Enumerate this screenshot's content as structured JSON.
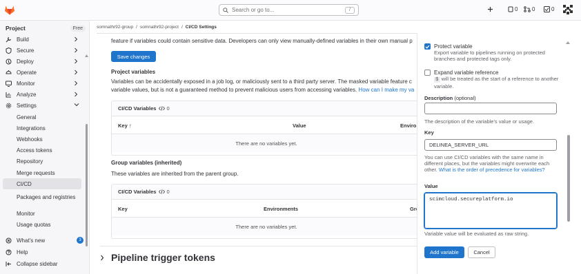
{
  "topbar": {
    "search_placeholder": "Search or go to...",
    "search_shortcut": "/",
    "issues_count": "0",
    "mr_count": "0",
    "todo_count": "0"
  },
  "sidebar": {
    "title": "Project",
    "badge": "Free",
    "items": [
      {
        "label": "Build",
        "icon": "build-icon"
      },
      {
        "label": "Secure",
        "icon": "shield-icon"
      },
      {
        "label": "Deploy",
        "icon": "deploy-icon"
      },
      {
        "label": "Operate",
        "icon": "operate-icon"
      },
      {
        "label": "Monitor",
        "icon": "monitor-icon"
      },
      {
        "label": "Analyze",
        "icon": "chart-icon"
      },
      {
        "label": "Settings",
        "icon": "gear-icon"
      }
    ],
    "settings_sub": [
      "General",
      "Integrations",
      "Webhooks",
      "Access tokens",
      "Repository",
      "Merge requests",
      "CI/CD",
      "Packages and registries",
      "Monitor",
      "Usage quotas"
    ],
    "active_sub": "CI/CD",
    "whats_new": "What's new",
    "whats_new_count": "3",
    "help": "Help",
    "collapse": "Collapse sidebar"
  },
  "breadcrumb": {
    "group": "somnathr92-group",
    "project": "somnathr92-project",
    "current": "CI/CD Settings",
    "sep": "/"
  },
  "main": {
    "intro": "feature if variables could contain sensitive data. Developers can only view manually-defined variables in their own manual p",
    "save_button": "Save changes",
    "project_vars_title": "Project variables",
    "project_vars_desc1": "Variables can be accidentally exposed in a job log, or maliciously sent to a third party server. The masked variable feature c",
    "project_vars_desc2": "variable values, but is not a guaranteed method to prevent malicious users from accessing variables.",
    "project_vars_link": "How can I make my va",
    "cicd_card_title": "CI/CD Variables",
    "cicd_card_count": "0",
    "col_key": "Key",
    "col_key_sort": "↑",
    "col_value": "Value",
    "col_environ_cut": "Enviro",
    "empty": "There are no variables yet.",
    "group_vars_title": "Group variables (inherited)",
    "group_vars_desc": "These variables are inherited from the parent group.",
    "group_card_title": "CI/CD Variables",
    "group_card_count": "0",
    "g_col_key": "Key",
    "g_col_env": "Environments",
    "g_col_gro_cut": "Gro",
    "g_empty": "There are no variables yet.",
    "pipeline_title": "Pipeline trigger tokens"
  },
  "drawer": {
    "protect_label": "Protect variable",
    "protect_checked": true,
    "protect_help": "Export variable to pipelines running on protected branches and protected tags only.",
    "expand_label": "Expand variable reference",
    "expand_checked": false,
    "expand_help_sym": "$",
    "expand_help": "will be treated as the start of a reference to another variable.",
    "desc_label": "Description",
    "desc_optional": "(optional)",
    "desc_value": "",
    "desc_help": "The description of the variable's value or usage.",
    "key_label": "Key",
    "key_value": "DELINEA_SERVER_URL",
    "key_help": "You can use CI/CD variables with the same name in different places, but the variables might overwrite each other.",
    "key_help_link": "What is the order of precedence for variables?",
    "value_label": "Value",
    "value_value": "scimcloud.secureplatform.io",
    "value_help": "Variable value will be evaluated as raw string.",
    "add_button": "Add variable",
    "cancel_button": "Cancel"
  },
  "colors": {
    "accent": "#1f75cb",
    "logo": "#fc6d26"
  }
}
